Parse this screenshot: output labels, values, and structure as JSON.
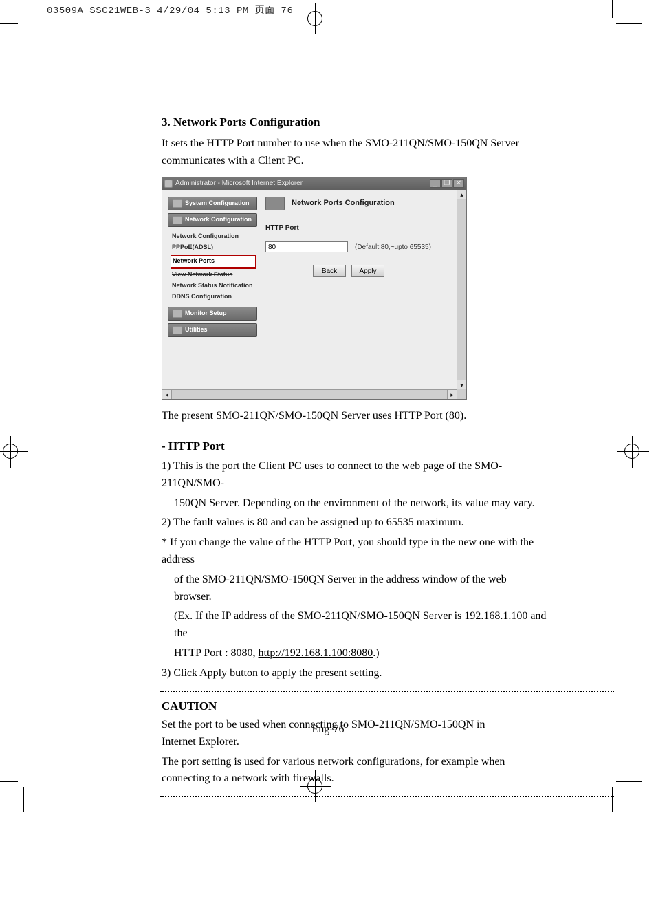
{
  "slug": "03509A SSC21WEB-3  4/29/04  5:13 PM  页面 76",
  "heading_main": "3. Network Ports Configuration",
  "intro": "It sets the HTTP Port number to use when the SMO-211QN/SMO-150QN Server communicates with a Client PC.",
  "screenshot": {
    "window_title": "Administrator - Microsoft Internet Explorer",
    "sidebar": {
      "btn_system": "System Configuration",
      "btn_network": "Network Configuration",
      "sub": {
        "item1": "Network Configuration",
        "item2": "PPPoE(ADSL)",
        "item3": "Network Ports",
        "item4": "View Network Status",
        "item5": "Network Status Notification",
        "item6": "DDNS Configuration"
      },
      "btn_monitor": "Monitor Setup",
      "btn_utilities": "Utilities"
    },
    "main": {
      "title": "Network Ports Configuration",
      "label_http_port": "HTTP Port",
      "value_http_port": "80",
      "hint": "(Default:80,~upto 65535)",
      "btn_back": "Back",
      "btn_apply": "Apply"
    },
    "winbtn_min": "_",
    "winbtn_max": "❐",
    "winbtn_close": "✕"
  },
  "after_shot": "The present SMO-211QN/SMO-150QN Server uses HTTP Port (80).",
  "heading_httpport": "- HTTP Port",
  "li1a": "1) This is the port the Client PC uses to connect to the web page of the SMO-211QN/SMO-",
  "li1b": "150QN Server. Depending on the environment of the network, its value may vary.",
  "li2": "2) The fault values is 80 and can be assigned up to 65535 maximum.",
  "note_a": "* If you change the value of the HTTP Port, you should type in the new one with the address",
  "note_b": "of the SMO-211QN/SMO-150QN Server in the address window of the web browser.",
  "note_c1": "(Ex. If the IP address of the SMO-211QN/SMO-150QN Server is 192.168.1.100 and the",
  "note_c2a": "HTTP Port : 8080, ",
  "note_c2b": "http://192.168.1.100:8080",
  "note_c2c": ".)",
  "li3": "3) Click Apply button to apply the present setting.",
  "caution_title": "CAUTION",
  "caution_p1": "Set the port to be used when connecting to SMO-211QN/SMO-150QN in Internet Explorer.",
  "caution_p2": "The port setting is used for various network configurations, for example when connecting to a network with firewalls.",
  "page_number": "Eng-76"
}
